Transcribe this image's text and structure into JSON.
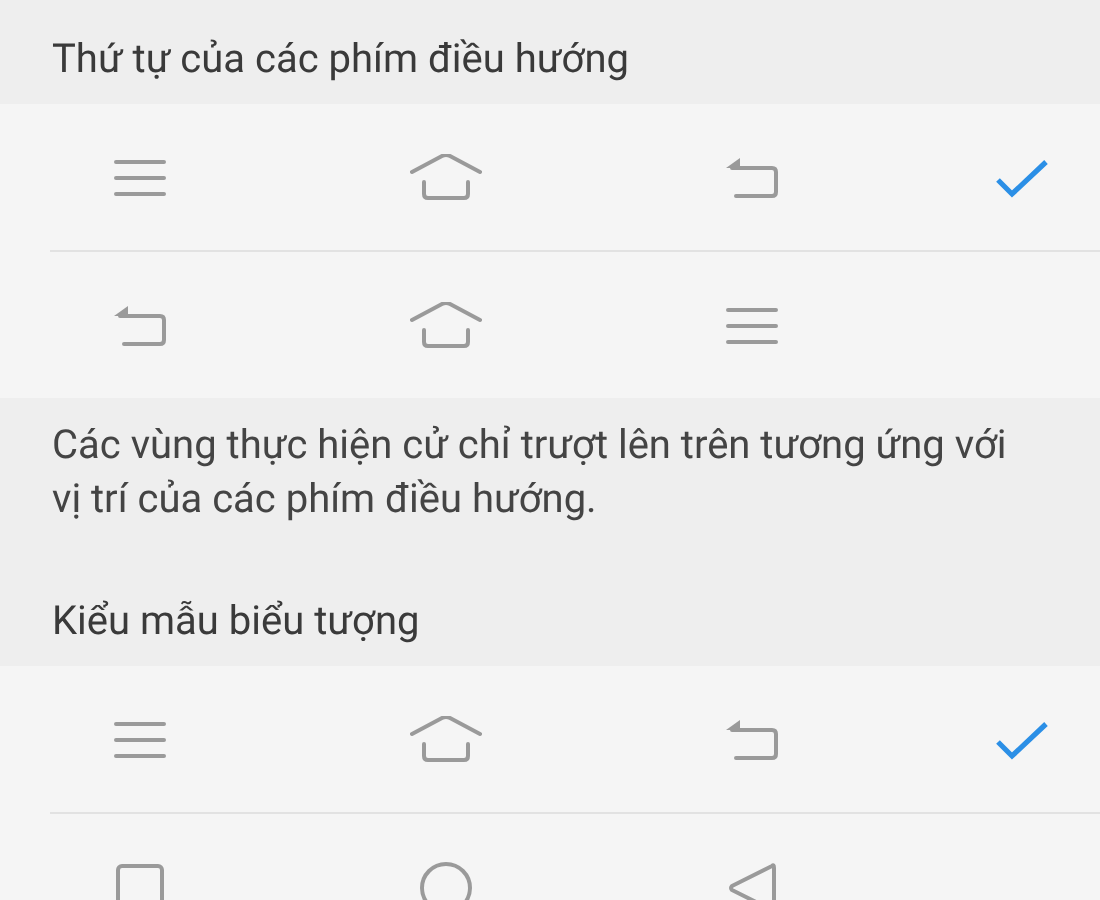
{
  "sections": [
    {
      "title": "Thứ tự của các phím điều hướng",
      "options": [
        {
          "icons": [
            {
              "kind": "menu"
            },
            {
              "kind": "home"
            },
            {
              "kind": "back"
            }
          ],
          "selected": true
        },
        {
          "icons": [
            {
              "kind": "back"
            },
            {
              "kind": "home"
            },
            {
              "kind": "menu"
            }
          ],
          "selected": false
        }
      ],
      "description": "Các vùng thực hiện cử chỉ trượt lên trên tương ứng với vị trí của các phím điều hướng."
    },
    {
      "title": "Kiểu mẫu biểu tượng",
      "options": [
        {
          "icons": [
            {
              "kind": "menu"
            },
            {
              "kind": "home"
            },
            {
              "kind": "back"
            }
          ],
          "selected": true
        },
        {
          "icons": [
            {
              "kind": "square"
            },
            {
              "kind": "circle"
            },
            {
              "kind": "triangle"
            }
          ],
          "selected": false
        }
      ]
    }
  ]
}
